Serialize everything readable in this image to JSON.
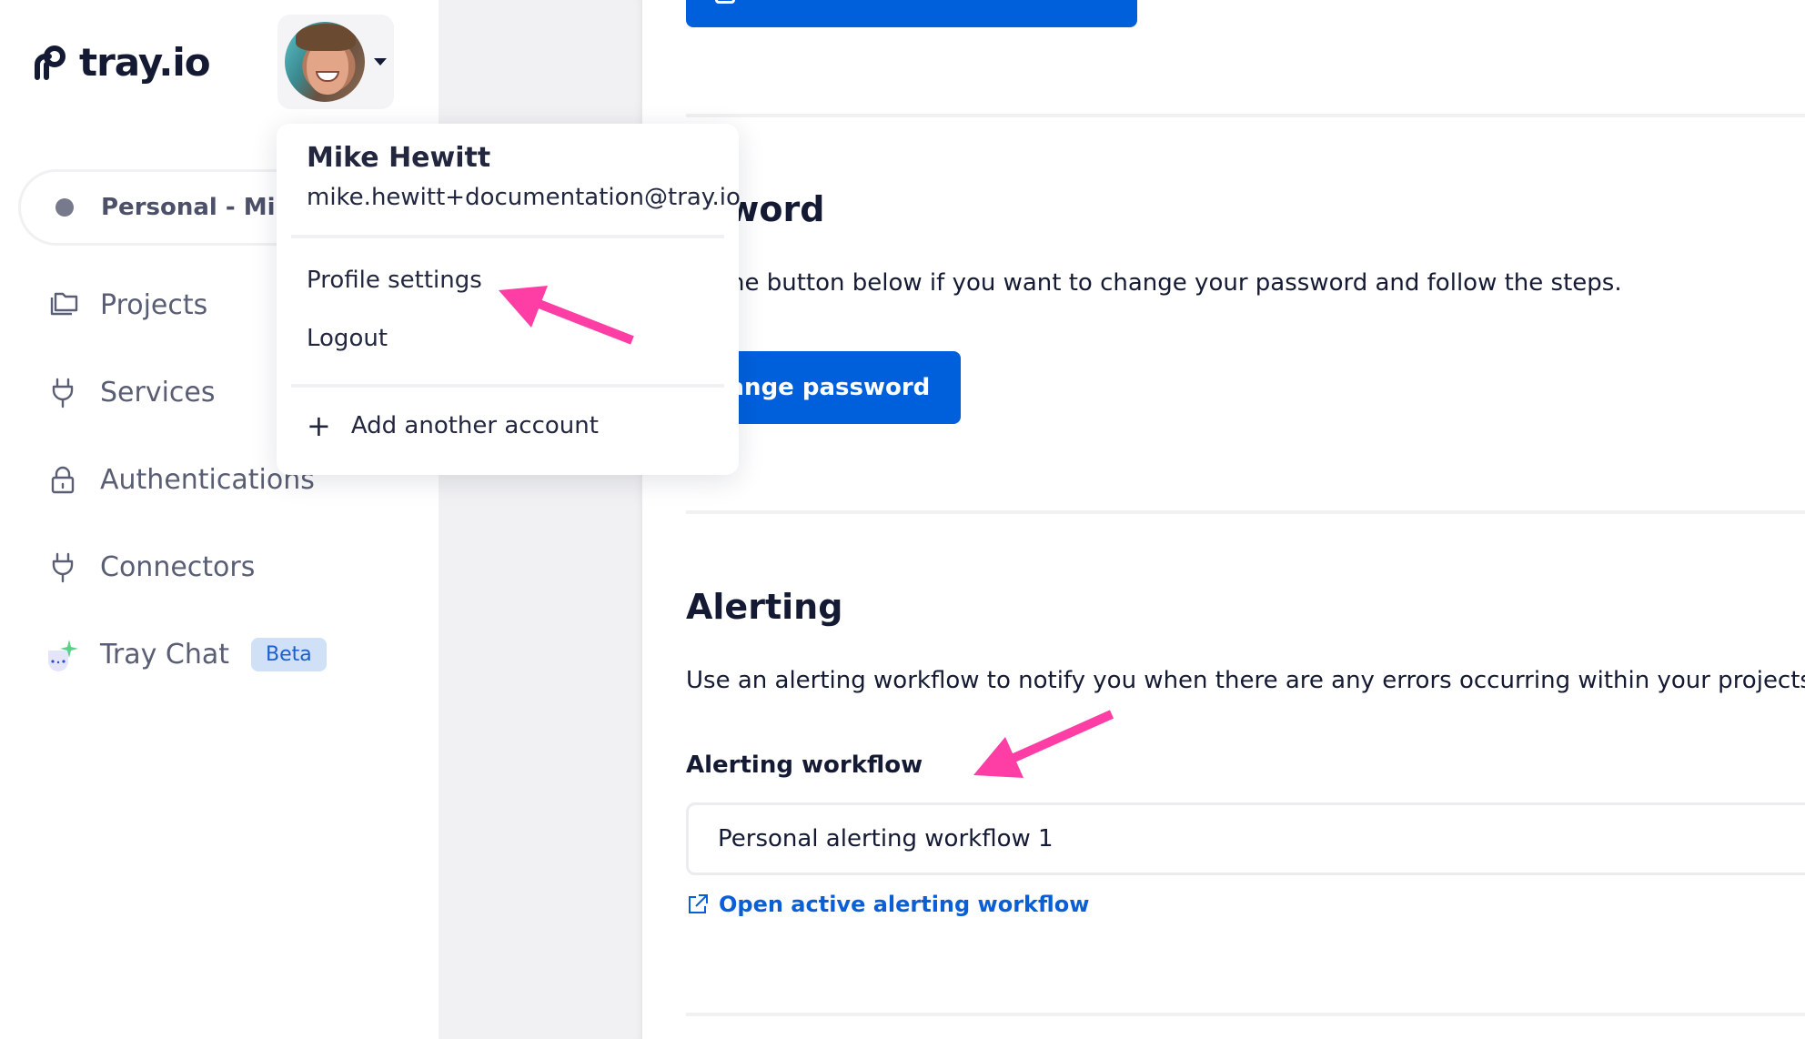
{
  "brand": {
    "name": "tray.io",
    "icon": "tray-logo-icon"
  },
  "user_menu": {
    "avatar_icon": "user-avatar",
    "caret_icon": "caret-down-icon",
    "name": "Mike Hewitt",
    "email": "mike.hewitt+documentation@tray.io",
    "items": [
      {
        "label": "Profile settings"
      },
      {
        "label": "Logout"
      }
    ],
    "add_account": {
      "icon": "plus-icon",
      "label": "Add another account"
    }
  },
  "workspace": {
    "label": "Personal - Mike Hewitt",
    "visible_label": "Personal - Mike",
    "status_color": "#777a8c"
  },
  "sidebar": {
    "items": [
      {
        "label": "Projects",
        "icon": "folder-icon"
      },
      {
        "label": "Services",
        "icon": "plug-icon"
      },
      {
        "label": "Authentications",
        "icon": "lock-icon"
      },
      {
        "label": "Connectors",
        "icon": "plug-icon"
      },
      {
        "label": "Tray Chat",
        "icon": "tray-chat-icon",
        "badge": "Beta"
      }
    ]
  },
  "main": {
    "password": {
      "title": "Password",
      "visible_title": "ssword",
      "description": "Use the button below if you want to change your password and follow the steps.",
      "visible_description": "se the button below if you want to change your password and follow the steps.",
      "button_label": "Change password",
      "visible_button_label": "hange password"
    },
    "alerting": {
      "title": "Alerting",
      "description": "Use an alerting workflow to notify you when there are any errors occurring within your projects",
      "field_label": "Alerting workflow",
      "selected_workflow": "Personal alerting workflow 1",
      "open_link": {
        "icon": "external-link-icon",
        "label": "Open active alerting workflow"
      }
    }
  },
  "colors": {
    "primary": "#0060dc",
    "link": "#0a5fd6",
    "annotation_arrow": "#ff3ea5",
    "text": "#141a33",
    "badge_bg": "#cfe0f7"
  }
}
